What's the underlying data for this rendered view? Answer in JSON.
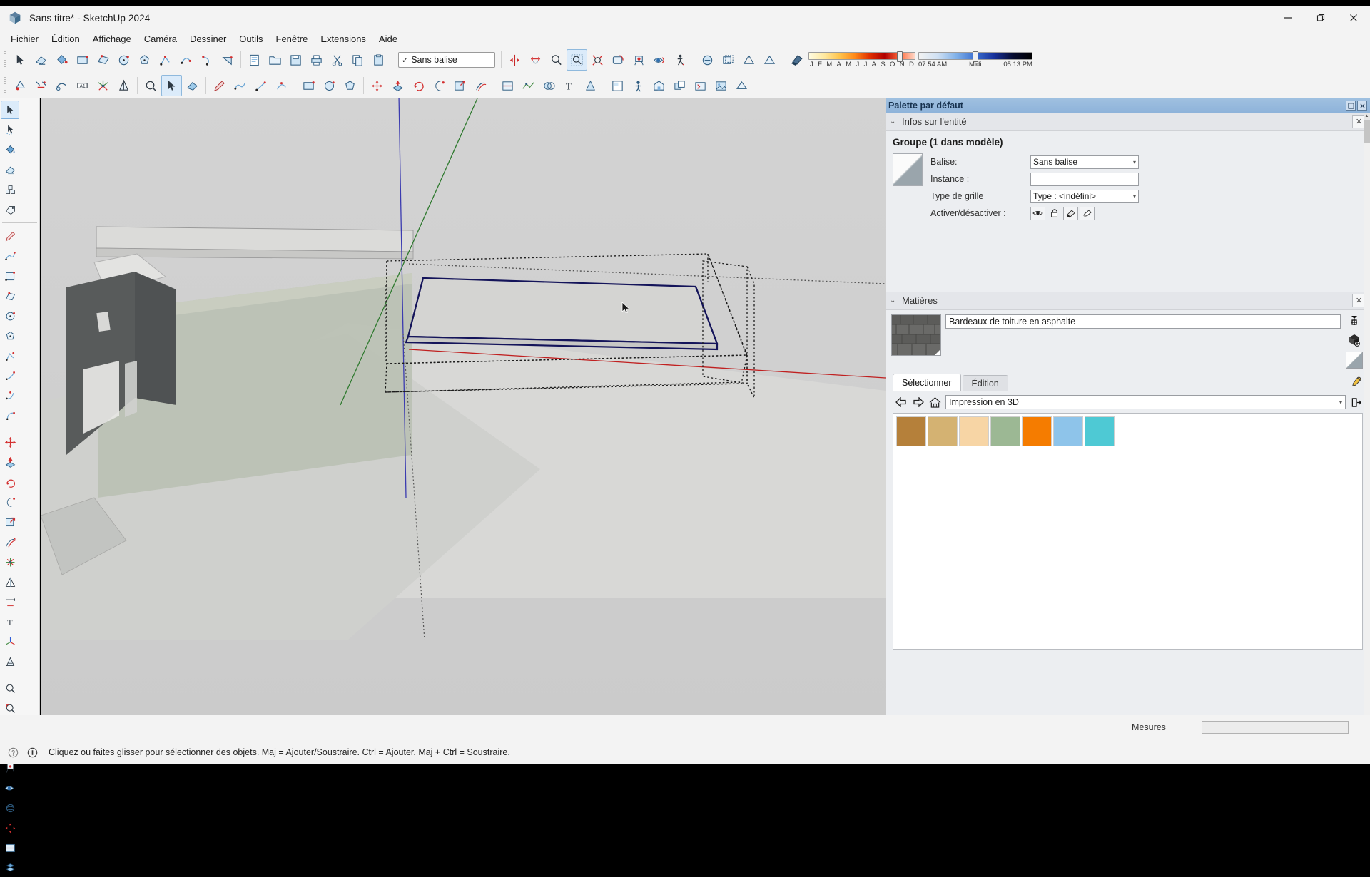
{
  "window": {
    "title": "Sans titre* - SketchUp 2024",
    "logo_icon": "sketchup-logo-icon",
    "minimize_label": "—",
    "maximize_label": "❐",
    "close_label": "✕"
  },
  "menubar": {
    "items": [
      {
        "label": "Fichier"
      },
      {
        "label": "Édition"
      },
      {
        "label": "Affichage"
      },
      {
        "label": "Caméra"
      },
      {
        "label": "Dessiner"
      },
      {
        "label": "Outils"
      },
      {
        "label": "Fenêtre"
      },
      {
        "label": "Extensions"
      },
      {
        "label": "Aide"
      }
    ]
  },
  "toolbars": {
    "row1_icons": [
      "select-icon",
      "eraser-icon",
      "paint-bucket-icon",
      "rectangle-icon",
      "rotated-rectangle-icon",
      "circle-icon",
      "polygon-icon",
      "line-icon",
      "arc-2pt-icon",
      "arc-3pt-icon",
      "pie-icon"
    ],
    "row1_right_icons": [
      "new-document-icon",
      "open-folder-icon",
      "save-icon",
      "print-icon",
      "cut-icon",
      "copy-icon",
      "paste-icon"
    ],
    "tag_selector": {
      "label": "Sans balise",
      "check_glyph": "✓",
      "arrow_glyph": "▾"
    },
    "camera_icons": [
      "flip-along-icon",
      "move-object-icon",
      "zoom-icon",
      "zoom-window-icon",
      "zoom-extents-icon",
      "previous-view-icon",
      "position-camera-icon",
      "look-around-icon",
      "walk-icon"
    ],
    "style_icons": [
      "xray-icon",
      "back-edges-icon",
      "wireframe-icon",
      "hidden-line-icon"
    ],
    "shadow": {
      "toggle_icon": "shadow-toggle-icon",
      "month_labels": [
        "J",
        "F",
        "M",
        "A",
        "M",
        "J",
        "J",
        "A",
        "S",
        "O",
        "N",
        "D"
      ],
      "month_position_pct": 86,
      "time_start": "07:54 AM",
      "time_noon": "Midi",
      "time_end": "05:13 PM",
      "time_position_pct": 50
    },
    "row2_icons": [
      "orbit-icon",
      "pan-icon",
      "tape-measure-icon",
      "dimension-icon",
      "protractor-icon",
      "text-icon",
      "axes-icon",
      "3d-text-icon",
      "zoom-magnifier-icon",
      "select-pointer-icon",
      "eraser2-icon",
      "pencil-icon",
      "freehand-icon",
      "line-tool-icon",
      "arc-tool-icon",
      "rectangle-tool-icon",
      "circle-tool-icon",
      "polygon-tool-icon",
      "move-tool-icon",
      "pushpull-tool-icon",
      "rotate-tool-icon",
      "followme-tool-icon",
      "scale-tool-icon",
      "offset-tool-icon",
      "section-plane-icon",
      "sandbox-icon",
      "solid-tools-icon",
      "layout-icon",
      "person-icon",
      "warehouse-icon",
      "component-icon",
      "dynamic-component-icon",
      "photo-texture-icon",
      "geo-location-icon"
    ]
  },
  "left_toolbar": {
    "groups": [
      [
        "select-arrow-icon",
        "lasso-select-icon"
      ],
      [
        "paint-bucket-icon",
        "eraser-icon"
      ],
      [
        "component-cubes-icon",
        "tag-label-icon"
      ],
      [
        "pencil-icon",
        "freehand-icon"
      ],
      [
        "rectangle-icon",
        "rotated-rectangle-icon"
      ],
      [
        "circle-icon",
        "polygon-icon"
      ],
      [
        "line-icon",
        "arc-icon"
      ],
      [
        "two-point-arc-icon",
        "three-point-arc-icon"
      ],
      [
        "move-icon",
        "pushpull-icon"
      ],
      [
        "rotate-icon",
        "followme-icon"
      ],
      [
        "scale-icon",
        "offset-icon"
      ],
      [
        "tape-measure-icon",
        "protractor-icon"
      ],
      [
        "dimension-icon",
        "text-icon"
      ],
      [
        "axes-icon",
        "3d-text-icon"
      ],
      [
        "zoom-icon",
        "zoom-window-icon"
      ],
      [
        "zoom-extents-icon",
        "walk-icon"
      ],
      [
        "position-camera-icon",
        "look-around-icon"
      ],
      [
        "orbit-icon",
        "pan-icon"
      ],
      [
        "section-plane-icon",
        "xray-icon"
      ]
    ],
    "active_index": 0
  },
  "right_panel": {
    "title": "Palette par défaut",
    "pin_icon": "pin-icon",
    "close_icon": "close-icon",
    "entity_info": {
      "header": "Infos sur l'entité",
      "chevron": "⌄",
      "close_glyph": "✕",
      "title": "Groupe (1 dans modèle)",
      "thumbnail_icon": "group-thumbnail-icon",
      "fields": [
        {
          "label": "Balise:",
          "type": "combo",
          "value": "Sans balise",
          "arrow": "▾"
        },
        {
          "label": "Instance :",
          "type": "text",
          "value": ""
        },
        {
          "label": "Type de grille",
          "type": "combo",
          "value": "Type : <indéfini>",
          "arrow": "▾"
        }
      ],
      "toggles_label": "Activer/désactiver :",
      "toggles": [
        "eye-visible-icon",
        "unlock-icon",
        "cast-shadow-icon",
        "receive-shadow-icon"
      ]
    },
    "materials": {
      "header": "Matières",
      "chevron": "⌄",
      "close_glyph": "✕",
      "swatch_preview_icon": "asphalt-shingle-texture",
      "name": "Bardeaux de toiture en asphalte",
      "side_buttons": [
        "list-display-icon",
        "create-material-icon",
        "default-material-icon"
      ],
      "tabs": [
        {
          "label": "Sélectionner",
          "selected": true
        },
        {
          "label": "Édition",
          "selected": false
        }
      ],
      "eyedropper_icon": "eyedropper-icon",
      "nav": {
        "back_icon": "arrow-left-icon",
        "forward_icon": "arrow-right-icon",
        "home_icon": "home-icon",
        "library": "Impression en 3D",
        "arrow": "▾",
        "details_icon": "details-menu-icon"
      },
      "swatches": [
        {
          "name": "brown-swatch",
          "color": "#b5803a"
        },
        {
          "name": "tan-swatch",
          "color": "#d4b272"
        },
        {
          "name": "peach-swatch",
          "color": "#f7d5a5"
        },
        {
          "name": "sage-green-swatch",
          "color": "#9cb894"
        },
        {
          "name": "orange-swatch",
          "color": "#f57c00"
        },
        {
          "name": "light-blue-swatch",
          "color": "#8ec4ea"
        },
        {
          "name": "turquoise-swatch",
          "color": "#4ec9d4"
        }
      ]
    }
  },
  "statusbar": {
    "help_icon": "help-circle-icon",
    "info_icon": "info-circle-icon",
    "message": "Cliquez ou faites glisser pour sélectionner des objets. Maj = Ajouter/Soustraire. Ctrl = Ajouter. Maj + Ctrl = Soustraire.",
    "measure_label": "Mesures",
    "measure_value": ""
  },
  "viewport": {
    "cursor_icon": "mouse-pointer-icon",
    "axis_blue": "#3b3bb0",
    "axis_green": "#2f7a2f",
    "axis_red": "#c02020",
    "background": "#cfcfcf",
    "selection_color": "#1a1a6e"
  }
}
